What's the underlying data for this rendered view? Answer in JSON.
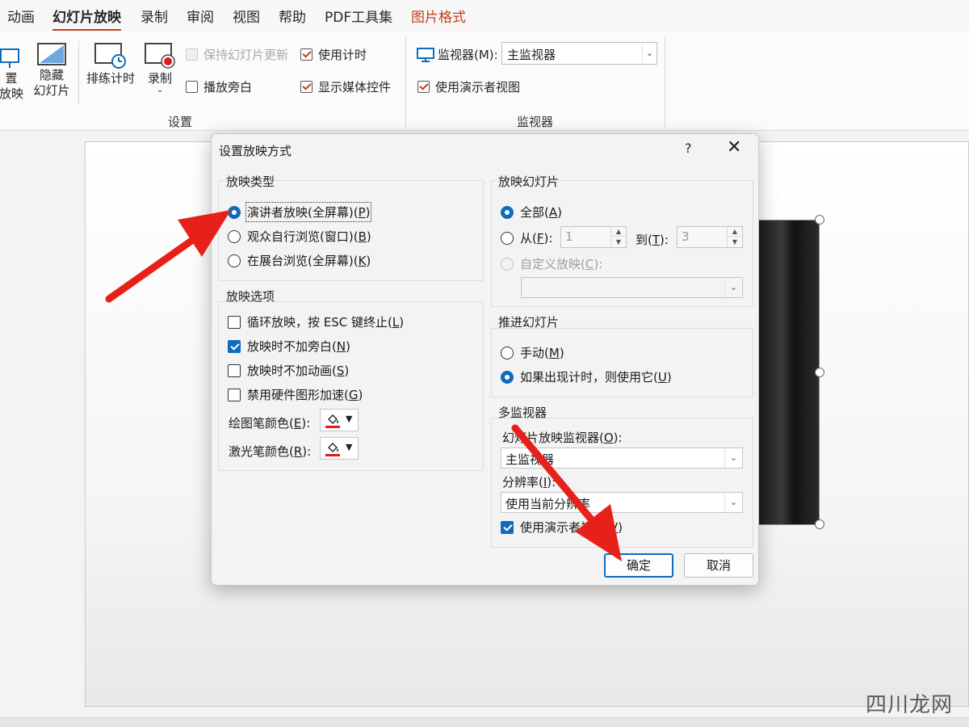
{
  "ribbon": {
    "tabs": [
      {
        "label": "动画"
      },
      {
        "label": "幻灯片放映"
      },
      {
        "label": "录制"
      },
      {
        "label": "审阅"
      },
      {
        "label": "视图"
      },
      {
        "label": "帮助"
      },
      {
        "label": "PDF工具集"
      },
      {
        "label": "图片格式"
      }
    ],
    "active_tab": "幻灯片放映",
    "buttons": {
      "setup_show_line1": "置",
      "setup_show_line2": "放映",
      "hide_slide_line1": "隐藏",
      "hide_slide_line2": "幻灯片",
      "rehearse": "排练计时",
      "record": "录制"
    },
    "checks": {
      "keep_updated": "保持幻灯片更新",
      "use_timings": "使用计时",
      "play_narration": "播放旁白",
      "show_media_controls": "显示媒体控件",
      "use_presenter_view": "使用演示者视图"
    },
    "monitor_label": "监视器(M):",
    "monitor_value": "主监视器",
    "groups": {
      "setup": "设置",
      "monitors": "监视器"
    }
  },
  "dialog": {
    "title": "设置放映方式",
    "help": "?",
    "close": "✕",
    "show_type": {
      "title": "放映类型",
      "options": [
        {
          "text": "演讲者放映(全屏幕)(",
          "key": "P",
          "tail": ")",
          "selected": true
        },
        {
          "text": "观众自行浏览(窗口)(",
          "key": "B",
          "tail": ")",
          "selected": false
        },
        {
          "text": "在展台浏览(全屏幕)(",
          "key": "K",
          "tail": ")",
          "selected": false
        }
      ]
    },
    "show_options": {
      "title": "放映选项",
      "checks": [
        {
          "text": "循环放映，按 ESC 键终止(",
          "key": "L",
          "tail": ")",
          "checked": false
        },
        {
          "text": "放映时不加旁白(",
          "key": "N",
          "tail": ")",
          "checked": true
        },
        {
          "text": "放映时不加动画(",
          "key": "S",
          "tail": ")",
          "checked": false
        },
        {
          "text": "禁用硬件图形加速(",
          "key": "G",
          "tail": ")",
          "checked": false
        }
      ],
      "pen_color_label": "绘图笔颜色(",
      "pen_color_key": "E",
      "pen_color_tail": "):",
      "laser_color_label": "激光笔颜色(",
      "laser_color_key": "R",
      "laser_color_tail": "):",
      "color_value": "#e01b1b"
    },
    "show_slides": {
      "title": "放映幻灯片",
      "all_text": "全部(",
      "all_key": "A",
      "all_tail": ")",
      "from_text": "从(",
      "from_key": "F",
      "from_tail": "):",
      "from_value": "1",
      "to_text": "到(",
      "to_key": "T",
      "to_tail": "):",
      "to_value": "3",
      "custom_text": "自定义放映(",
      "custom_key": "C",
      "custom_tail": "):"
    },
    "advance": {
      "title": "推进幻灯片",
      "manual_text": "手动(",
      "manual_key": "M",
      "manual_tail": ")",
      "timings_text": "如果出现计时，则使用它(",
      "timings_key": "U",
      "timings_tail": ")"
    },
    "multi_monitor": {
      "title": "多监视器",
      "monitor_label": "幻灯片放映监视器(",
      "monitor_key": "O",
      "monitor_tail": "):",
      "monitor_value": "主监视器",
      "resolution_label": "分辨率(",
      "resolution_key": "I",
      "resolution_tail": "):",
      "resolution_value": "使用当前分辨率",
      "presenter_text": "使用演示者视图(",
      "presenter_key": "V",
      "presenter_tail": ")"
    },
    "ok_label": "确定",
    "cancel_label": "取消"
  },
  "colors": {
    "accent": "#c43e1c",
    "selection_blue": "#0f6cbd",
    "annotation_arrow": "#e8201a"
  },
  "watermark": "四川龙网"
}
